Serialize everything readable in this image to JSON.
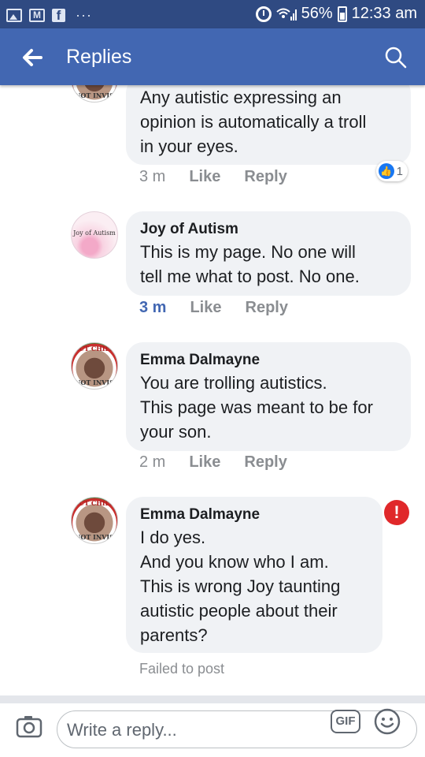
{
  "status_bar": {
    "icons_left": [
      "gallery-icon",
      "gmail-icon",
      "facebook-icon",
      "more-icon"
    ],
    "mail_glyph": "M",
    "fb_glyph": "f",
    "dots": "···",
    "battery_percent": "56%",
    "time": "12:33 am"
  },
  "app_bar": {
    "title": "Replies",
    "color": "#4267b2"
  },
  "comments": [
    {
      "author": "",
      "avatar": "emma-avatar",
      "text": "Any autistic expressing an\nopinion is automatically a troll\nin your eyes.",
      "time": "3 m",
      "like_label": "Like",
      "reply_label": "Reply",
      "reactions": {
        "type": "like",
        "count": "1"
      }
    },
    {
      "author": "Joy of Autism",
      "avatar_text": "Joy of Autism",
      "text": "This is my page. No one will\ntell me what to post. No one.",
      "time": "3 m",
      "like_label": "Like",
      "reply_label": "Reply"
    },
    {
      "author": "Emma Dalmayne",
      "text": "You are trolling autistics.\nThis page was meant to be for\nyour son.",
      "time": "2 m",
      "like_label": "Like",
      "reply_label": "Reply"
    },
    {
      "author": "Emma Dalmayne",
      "text": "I do yes.\nAnd you know who I am.\nThis is wrong Joy taunting\nautistic people about their\nparents?",
      "status": "Failed to post",
      "error_glyph": "!"
    }
  ],
  "composer": {
    "placeholder": "Write a reply...",
    "gif_label": "GIF"
  }
}
